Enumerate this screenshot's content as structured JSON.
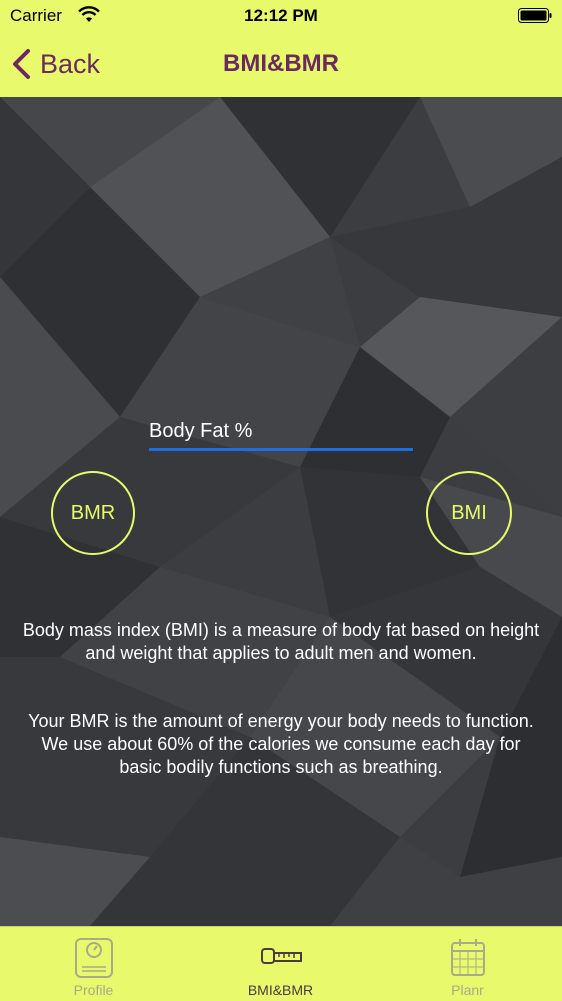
{
  "status_bar": {
    "carrier": "Carrier",
    "time": "12:12 PM"
  },
  "nav": {
    "back_label": "Back",
    "title": "BMI&BMR"
  },
  "form": {
    "body_fat_placeholder": "Body Fat %"
  },
  "buttons": {
    "bmr": "BMR",
    "bmi": "BMI"
  },
  "description": {
    "bmi": "Body mass index (BMI) is a measure of body fat based on height and weight that applies to adult men and women.",
    "bmr": "Your BMR is the amount of energy your body needs to function. We use about 60% of the calories we consume each day for basic bodily functions such as breathing."
  },
  "tabs": [
    {
      "label": "Profile",
      "icon": "scale-icon",
      "active": false
    },
    {
      "label": "BMI&BMR",
      "icon": "tape-measure-icon",
      "active": true
    },
    {
      "label": "Planr",
      "icon": "calendar-icon",
      "active": false
    }
  ],
  "colors": {
    "accent": "#e8fa6c",
    "nav_text": "#6b2a5f",
    "field_underline": "#1c6fe3"
  }
}
